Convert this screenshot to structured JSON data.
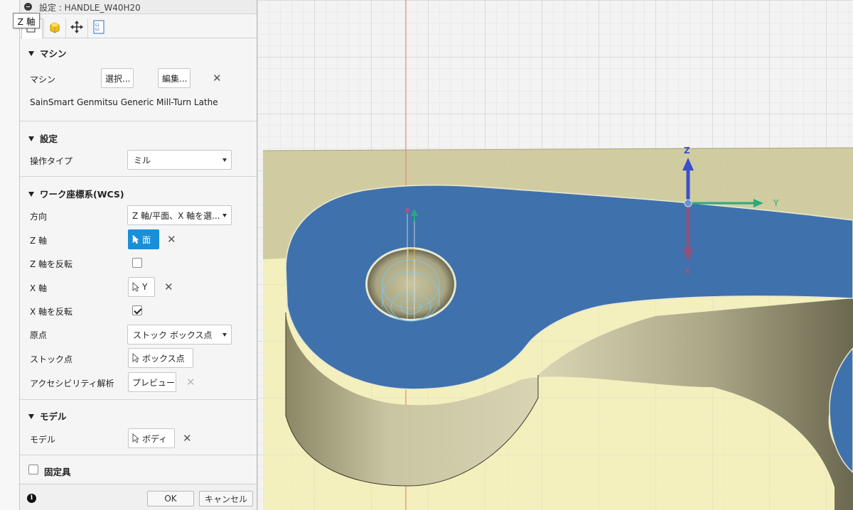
{
  "tooltip": "Z 軸",
  "dialog": {
    "title": "設定 : HANDLE_W40H20",
    "tabs": [
      {
        "icon": "setup-tab-icon",
        "active": true
      },
      {
        "icon": "stock-cube-icon",
        "active": false
      },
      {
        "icon": "move-arrows-icon",
        "active": false
      },
      {
        "icon": "post-nc-icon",
        "active": false
      }
    ]
  },
  "machine": {
    "header": "マシン",
    "label": "マシン",
    "select_button": "選択...",
    "edit_button": "編集...",
    "machine_name": "SainSmart Genmitsu Generic Mill-Turn Lathe"
  },
  "setup": {
    "header": "設定",
    "operation_type_label": "操作タイプ",
    "operation_type_value": "ミル"
  },
  "wcs": {
    "header": "ワーク座標系(WCS)",
    "orientation_label": "方向",
    "orientation_value": "Z 軸/平面、X 軸を選...",
    "z_axis_label": "Z 軸",
    "z_axis_value": "面",
    "z_flip_label": "Z 軸を反転",
    "z_flip_checked": false,
    "x_axis_label": "X 軸",
    "x_axis_value": "Y",
    "x_flip_label": "X 軸を反転",
    "x_flip_checked": true,
    "origin_label": "原点",
    "origin_value": "ストック ボックス点",
    "stock_point_label": "ストック点",
    "stock_point_value": "ボックス点",
    "accessibility_label": "アクセシビリティ解析",
    "accessibility_value": "プレビュー"
  },
  "model": {
    "header": "モデル",
    "label": "モデル",
    "value": "ボディ"
  },
  "fixture": {
    "label": "固定具",
    "checked": false
  },
  "footer": {
    "ok": "OK",
    "cancel": "キャンセル"
  },
  "triad": {
    "z_label": "Z",
    "y_label": "Y",
    "x_label": "X"
  },
  "colors": {
    "selected_blue": "#1b8ed8",
    "face_blue": "#3f71ad",
    "stock_yellow": "#f3f0b8",
    "triad_z": "#3d4fc9",
    "triad_y": "#2aa97f",
    "triad_x": "#b0527e"
  }
}
